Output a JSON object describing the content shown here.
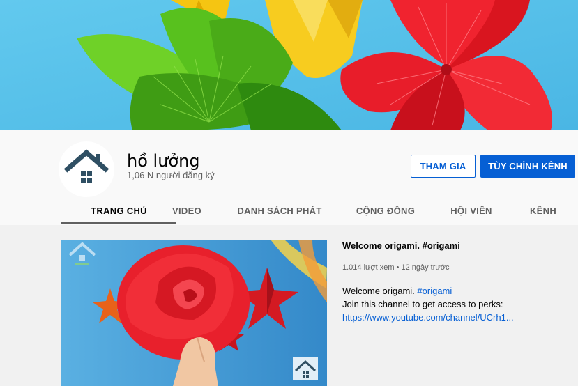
{
  "channel": {
    "name": "hồ lưởng",
    "subscribers": "1,06 N người đăng ký"
  },
  "buttons": {
    "join": "THAM GIA",
    "customize": "TÙY CHỈNH KÊNH"
  },
  "tabs": [
    {
      "label": "TRANG CHỦ",
      "active": true
    },
    {
      "label": "VIDEO"
    },
    {
      "label": "DANH SÁCH PHÁT"
    },
    {
      "label": "CỘNG ĐỒNG"
    },
    {
      "label": "HỘI VIÊN"
    },
    {
      "label": "KÊNH"
    }
  ],
  "featured_video": {
    "title": "Welcome origami. #origami",
    "meta": "1.014 lượt xem • 12 ngày trước",
    "desc_line1_text": "Welcome origami. ",
    "desc_line1_tag": "#origami",
    "desc_line2": "Join this channel to get access to perks:",
    "desc_line3_link": "https://www.youtube.com/channel/UCrh1..."
  },
  "colors": {
    "accent": "#065fd4",
    "avatar_house": "#2f4f63"
  },
  "icons": {
    "avatar": "house-icon",
    "watermark": "house-icon"
  }
}
